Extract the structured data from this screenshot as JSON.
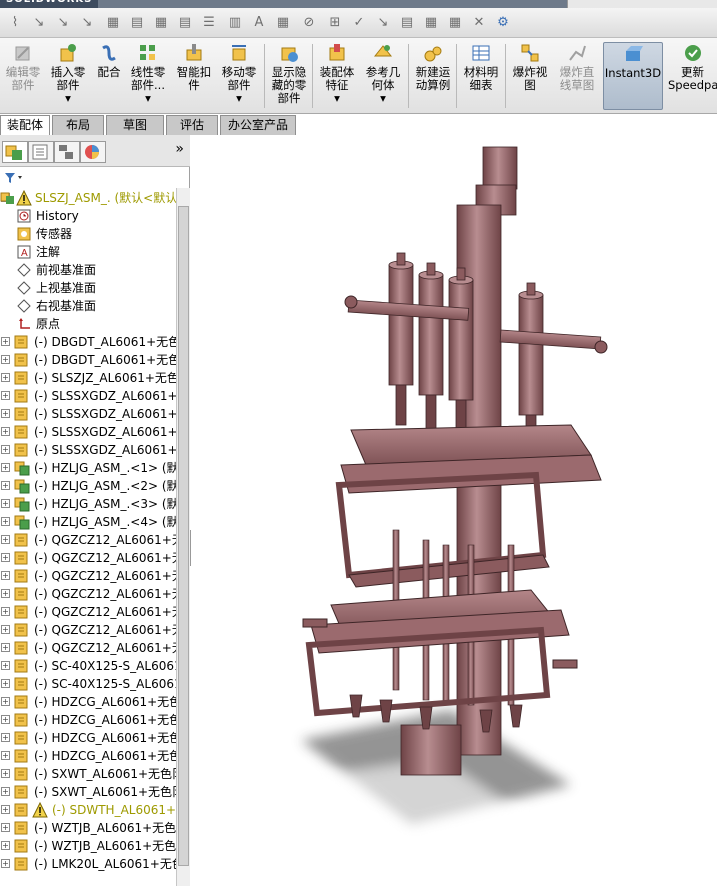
{
  "app": {
    "brand": "SOLIDWORKS"
  },
  "ribbon": {
    "buttons": [
      {
        "label": "编辑零部件",
        "icon": "edit-component-icon",
        "enabled": false
      },
      {
        "label": "插入零部件",
        "icon": "insert-component-icon",
        "enabled": true,
        "has_menu": true
      },
      {
        "label": "配合",
        "icon": "mate-icon",
        "enabled": true
      },
      {
        "label": "线性零部件...",
        "icon": "linear-pattern-icon",
        "enabled": true,
        "has_menu": true
      },
      {
        "label": "智能扣件",
        "icon": "smart-fastener-icon",
        "enabled": true
      },
      {
        "label": "移动零部件",
        "icon": "move-component-icon",
        "enabled": true,
        "has_menu": true
      },
      {
        "label": "显示隐藏的零部件",
        "icon": "show-hidden-icon",
        "enabled": true
      },
      {
        "label": "装配体特征",
        "icon": "assembly-feature-icon",
        "enabled": true,
        "has_menu": true
      },
      {
        "label": "参考几何体",
        "icon": "reference-geometry-icon",
        "enabled": true,
        "has_menu": true
      },
      {
        "label": "新建运动算例",
        "icon": "motion-study-icon",
        "enabled": true
      },
      {
        "label": "材料明细表",
        "icon": "bom-icon",
        "enabled": true
      },
      {
        "label": "爆炸视图",
        "icon": "exploded-view-icon",
        "enabled": true
      },
      {
        "label": "爆炸直线草图",
        "icon": "explode-line-sketch-icon",
        "enabled": false
      },
      {
        "label": "Instant3D",
        "icon": "instant3d-icon",
        "enabled": true,
        "selected": true
      },
      {
        "label": "更新Speedpa",
        "icon": "speedpak-icon",
        "enabled": true
      }
    ]
  },
  "tabs": [
    "装配体",
    "布局",
    "草图",
    "评估",
    "办公室产品"
  ],
  "active_tab": "装配体",
  "tree": {
    "root": "SLSZJ_ASM_.  (默认<默认",
    "items": [
      {
        "label": "History",
        "icon": "history-icon",
        "expandable": false
      },
      {
        "label": "传感器",
        "icon": "sensor-icon",
        "expandable": false
      },
      {
        "label": "注解",
        "icon": "annotation-icon",
        "expandable": false
      },
      {
        "label": "前视基准面",
        "icon": "plane-icon",
        "expandable": false
      },
      {
        "label": "上视基准面",
        "icon": "plane-icon",
        "expandable": false
      },
      {
        "label": "右视基准面",
        "icon": "plane-icon",
        "expandable": false
      },
      {
        "label": "原点",
        "icon": "origin-icon",
        "expandable": false
      },
      {
        "label": "(-) DBGDT_AL6061+无色",
        "icon": "part-icon",
        "expandable": true
      },
      {
        "label": "(-) DBGDT_AL6061+无色",
        "icon": "part-icon",
        "expandable": true
      },
      {
        "label": "(-) SLSZJZ_AL6061+无色",
        "icon": "part-icon",
        "expandable": true
      },
      {
        "label": "(-) SLSSXGDZ_AL6061+无",
        "icon": "part-icon",
        "expandable": true
      },
      {
        "label": "(-) SLSSXGDZ_AL6061+无",
        "icon": "part-icon",
        "expandable": true
      },
      {
        "label": "(-) SLSSXGDZ_AL6061+无",
        "icon": "part-icon",
        "expandable": true
      },
      {
        "label": "(-) SLSSXGDZ_AL6061+无",
        "icon": "part-icon",
        "expandable": true
      },
      {
        "label": "(-) HZLJG_ASM_.<1> (默",
        "icon": "subassembly-icon",
        "expandable": true
      },
      {
        "label": "(-) HZLJG_ASM_.<2> (默",
        "icon": "subassembly-icon",
        "expandable": true
      },
      {
        "label": "(-) HZLJG_ASM_.<3> (默",
        "icon": "subassembly-icon",
        "expandable": true
      },
      {
        "label": "(-) HZLJG_ASM_.<4> (默",
        "icon": "subassembly-icon",
        "expandable": true
      },
      {
        "label": "(-) QGZCZ12_AL6061+无",
        "icon": "part-icon",
        "expandable": true
      },
      {
        "label": "(-) QGZCZ12_AL6061+无",
        "icon": "part-icon",
        "expandable": true
      },
      {
        "label": "(-) QGZCZ12_AL6061+无",
        "icon": "part-icon",
        "expandable": true
      },
      {
        "label": "(-) QGZCZ12_AL6061+无",
        "icon": "part-icon",
        "expandable": true
      },
      {
        "label": "(-) QGZCZ12_AL6061+无",
        "icon": "part-icon",
        "expandable": true
      },
      {
        "label": "(-) QGZCZ12_AL6061+无",
        "icon": "part-icon",
        "expandable": true
      },
      {
        "label": "(-) QGZCZ12_AL6061+无",
        "icon": "part-icon",
        "expandable": true
      },
      {
        "label": "(-) SC-40X125-S_AL6061",
        "icon": "part-icon",
        "expandable": true
      },
      {
        "label": "(-) SC-40X125-S_AL6061",
        "icon": "part-icon",
        "expandable": true
      },
      {
        "label": "(-) HDZCG_AL6061+无色",
        "icon": "part-icon",
        "expandable": true
      },
      {
        "label": "(-) HDZCG_AL6061+无色",
        "icon": "part-icon",
        "expandable": true
      },
      {
        "label": "(-) HDZCG_AL6061+无色",
        "icon": "part-icon",
        "expandable": true
      },
      {
        "label": "(-) HDZCG_AL6061+无色",
        "icon": "part-icon",
        "expandable": true
      },
      {
        "label": "(-) SXWT_AL6061+无色阝",
        "icon": "part-icon",
        "expandable": true
      },
      {
        "label": "(-) SXWT_AL6061+无色阝",
        "icon": "part-icon",
        "expandable": true
      },
      {
        "label": "(-) SDWTH_AL6061+无",
        "icon": "part-icon",
        "expandable": true,
        "warning": true
      },
      {
        "label": "(-) WZTJB_AL6061+无色",
        "icon": "part-icon",
        "expandable": true
      },
      {
        "label": "(-) WZTJB_AL6061+无色",
        "icon": "part-icon",
        "expandable": true
      },
      {
        "label": "(-) LMK20L_AL6061+无色",
        "icon": "part-icon",
        "expandable": true
      }
    ]
  },
  "colors": {
    "model": "#9b6a6e",
    "model_dark": "#6e4346",
    "model_light": "#c99ea1",
    "shadow": "#3c3c3c",
    "warning": "#9e9a00"
  }
}
